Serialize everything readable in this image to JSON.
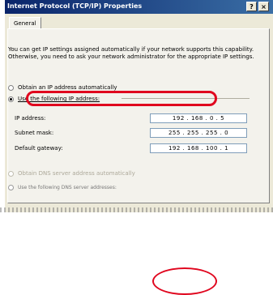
{
  "window": {
    "title": "Internet Protocol (TCP/IP) Properties",
    "help_label": "?",
    "close_label": "×"
  },
  "tabs": [
    {
      "label": "General"
    }
  ],
  "description": "You can get IP settings assigned automatically if your network supports this capability. Otherwise, you need to ask your network administrator for the appropriate IP settings.",
  "ip_options": {
    "auto_label": "Obtain an IP address automatically",
    "manual_label": "Use the following IP address:",
    "selected": "manual"
  },
  "fields": [
    {
      "label": "IP address:",
      "value": "192 . 168 . 0 . 5"
    },
    {
      "label": "Subnet mask:",
      "value": "255 . 255 . 255 . 0"
    },
    {
      "label": "Default gateway:",
      "value": "192 . 168 . 100 . 1"
    }
  ],
  "dns_options": {
    "auto_label": "Obtain DNS server address automatically",
    "manual_label": "Use the following DNS server addresses:"
  },
  "colors": {
    "highlight": "#e0061e",
    "title_bar": "#0a246a"
  }
}
